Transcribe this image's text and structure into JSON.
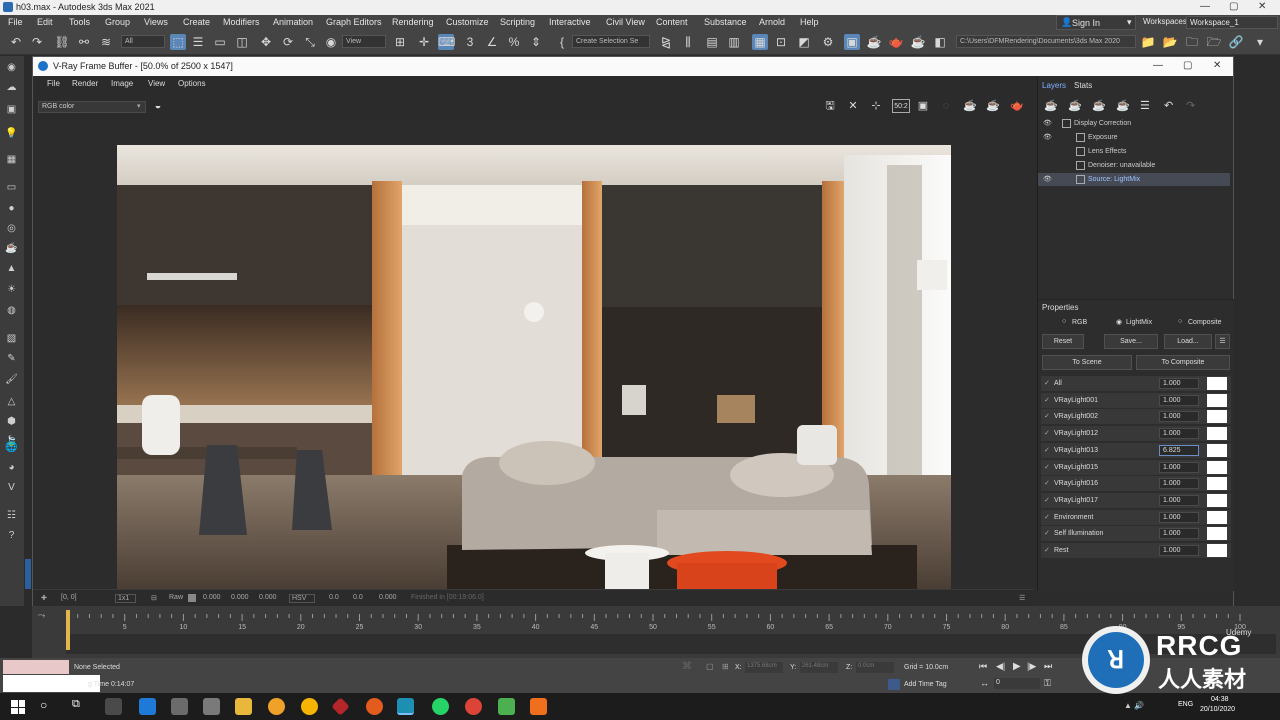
{
  "app": {
    "title": "h03.max - Autodesk 3ds Max 2021",
    "window_controls": [
      "—",
      "▢",
      "✕"
    ]
  },
  "menubar": {
    "items": [
      "File",
      "Edit",
      "Tools",
      "Group",
      "Views",
      "Create",
      "Modifiers",
      "Animation",
      "Graph Editors",
      "Rendering",
      "Customize",
      "Scripting",
      "Interactive",
      "Civil View",
      "Content",
      "Substance",
      "Arnold",
      "Help"
    ],
    "sign_in": "Sign In",
    "workspaces_label": "Workspaces:",
    "workspace_value": "Workspace_1"
  },
  "toolbar": {
    "filter_value": "All",
    "view_value": "View",
    "selection_set_placeholder": "Create Selection Se",
    "project_path": "C:\\Users\\DFMRendering\\Documents\\3ds Max 2020"
  },
  "vfb": {
    "title": "V-Ray Frame Buffer - [50.0% of 2500 x 1547]",
    "menu": [
      "File",
      "Render",
      "Image",
      "View",
      "Options"
    ],
    "channel": "RGB color",
    "tool_label_50": "50:2",
    "status": {
      "coords": "[0, 0]",
      "zoom": "1x1",
      "raw_label": "Raw",
      "raw_values": [
        "0.000",
        "0.000",
        "0.000"
      ],
      "color_mode": "HSV",
      "hsv_values": [
        "0.0",
        "0.0",
        "0.000"
      ],
      "finished": "Finished in [00:19:06.0]"
    }
  },
  "layers": {
    "tabs": [
      "Layers",
      "Stats"
    ],
    "tree": [
      {
        "label": "Display Correction",
        "eye": true
      },
      {
        "label": "Exposure",
        "eye": true
      },
      {
        "label": "Lens Effects",
        "eye": false
      },
      {
        "label": "Denoiser: unavailable",
        "eye": false
      },
      {
        "label": "Source: LightMix",
        "eye": true,
        "selected": true
      }
    ]
  },
  "properties": {
    "title": "Properties",
    "modes": [
      "RGB",
      "LightMix",
      "Composite"
    ],
    "selected_mode": "LightMix",
    "buttons": [
      "Reset",
      "Save...",
      "Load..."
    ],
    "to_scene": "To Scene",
    "to_composite": "To Composite",
    "lights": [
      {
        "name": "All",
        "value": "1.000"
      },
      {
        "name": "VRayLight001",
        "value": "1.000"
      },
      {
        "name": "VRayLight002",
        "value": "1.000"
      },
      {
        "name": "VRayLight012",
        "value": "1.000"
      },
      {
        "name": "VRayLight013",
        "value": "6.825",
        "highlight": true
      },
      {
        "name": "VRayLight015",
        "value": "1.000"
      },
      {
        "name": "VRayLight016",
        "value": "1.000"
      },
      {
        "name": "VRayLight017",
        "value": "1.000"
      },
      {
        "name": "Environment",
        "value": "1.000"
      },
      {
        "name": "Self Illumination",
        "value": "1.000"
      },
      {
        "name": "Rest",
        "value": "1.000"
      }
    ]
  },
  "timeline": {
    "ticks": [
      "0",
      "5",
      "10",
      "15",
      "20",
      "25",
      "30",
      "35",
      "40",
      "45",
      "50",
      "55",
      "60",
      "65",
      "70",
      "75",
      "80",
      "85",
      "90",
      "95",
      "100"
    ]
  },
  "statusbar": {
    "selection": "None Selected",
    "rendering_time": "g Time 0:14:07",
    "x_label": "X:",
    "x_value": "1375.68cm",
    "y_label": "Y:",
    "y_value": "261.48cm",
    "z_label": "Z:",
    "z_value": "0.0cm",
    "grid": "Grid = 10.0cm",
    "add_time_tag": "Add Time Tag",
    "frame_value": "0"
  },
  "taskbar": {
    "lang": "ENG",
    "time": "04:38",
    "date": "20/10/2020"
  },
  "watermark": {
    "text1": "RRCG",
    "text2": "人人素材",
    "text3": "Udemy"
  },
  "colors": {
    "accent": "#5a86b8",
    "panel": "#2d2d2d",
    "watermark_blue": "#1e6fb8"
  }
}
